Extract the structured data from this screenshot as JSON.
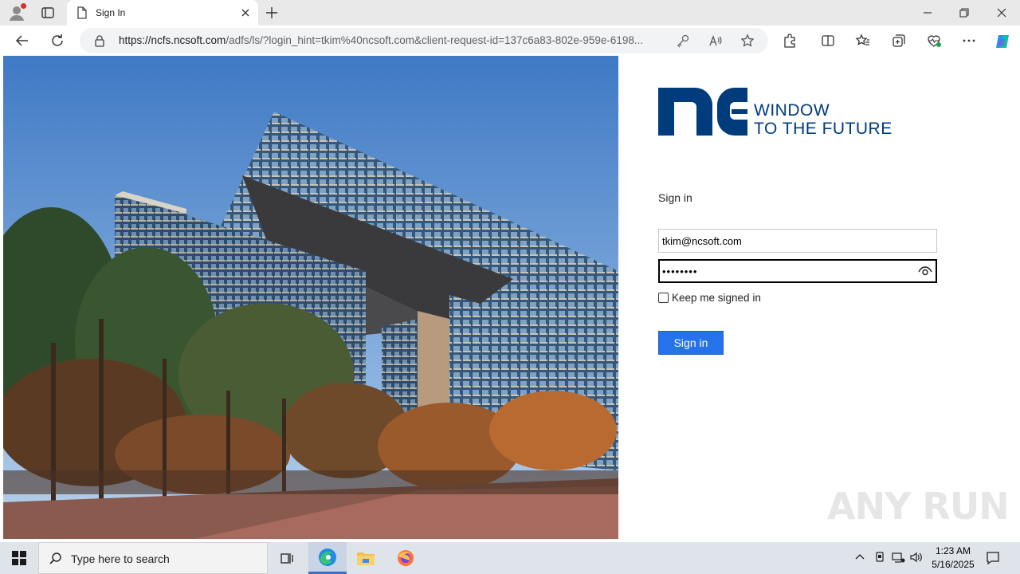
{
  "browser": {
    "tab_title": "Sign In",
    "url_host": "https://ncfs.ncsoft.com",
    "url_rest": "/adfs/ls/?login_hint=tkim%40ncsoft.com&client-request-id=137c6a83-802e-959e-6198..."
  },
  "signin": {
    "logo_line1": "WINDOW",
    "logo_line2": "TO THE FUTURE",
    "heading": "Sign in",
    "email_value": "tkim@ncsoft.com",
    "password_value": "••••••••",
    "keep_signed_in_label": "Keep me signed in",
    "keep_signed_in_checked": false,
    "submit_label": "Sign in",
    "accent_color": "#2672ec",
    "logo_color": "#003b7c"
  },
  "watermark": "ANY RUN",
  "taskbar": {
    "search_placeholder": "Type here to search",
    "time": "1:23 AM",
    "date": "5/16/2025"
  }
}
